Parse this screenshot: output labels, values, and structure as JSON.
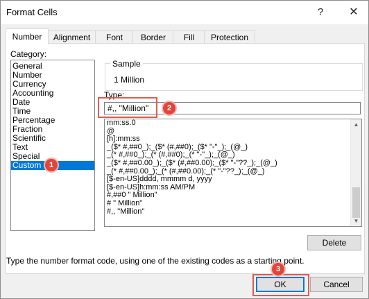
{
  "window": {
    "title": "Format Cells",
    "help_glyph": "?",
    "close_glyph": "✕"
  },
  "tabs": [
    {
      "label": "Number",
      "active": true
    },
    {
      "label": "Alignment"
    },
    {
      "label": "Font"
    },
    {
      "label": "Border"
    },
    {
      "label": "Fill"
    },
    {
      "label": "Protection"
    }
  ],
  "category": {
    "label": "Category:",
    "items": [
      "General",
      "Number",
      "Currency",
      "Accounting",
      "Date",
      "Time",
      "Percentage",
      "Fraction",
      "Scientific",
      "Text",
      "Special",
      "Custom"
    ],
    "selected": "Custom"
  },
  "sample": {
    "legend": "Sample",
    "value": "1 Million"
  },
  "type": {
    "label": "Type:",
    "value": "#,, \"Million\""
  },
  "format_list": [
    "mm:ss.0",
    "@",
    "[h]:mm:ss",
    "_($* #,##0_);_($* (#,##0);_($* \"-\"_);_(@_)",
    "_(* #,##0_);_(* (#,##0);_(* \"-\"_);_(@_)",
    "_($* #,##0.00_);_($* (#,##0.00);_($* \"-\"??_);_(@_)",
    "_(* #,##0.00_);_(* (#,##0.00);_(* \"-\"??_);_(@_)",
    "[$-en-US]dddd, mmmm d, yyyy",
    "[$-en-US]h:mm:ss AM/PM",
    "#,##0 \" Million\"",
    "# \" Million\"",
    "#,, \"Million\""
  ],
  "buttons": {
    "delete": "Delete",
    "ok": "OK",
    "cancel": "Cancel"
  },
  "hint": "Type the number format code, using one of the existing codes as a starting point.",
  "callouts": [
    "1",
    "2",
    "3"
  ],
  "colors": {
    "selection": "#0078d7",
    "callout": "#e0453a"
  }
}
